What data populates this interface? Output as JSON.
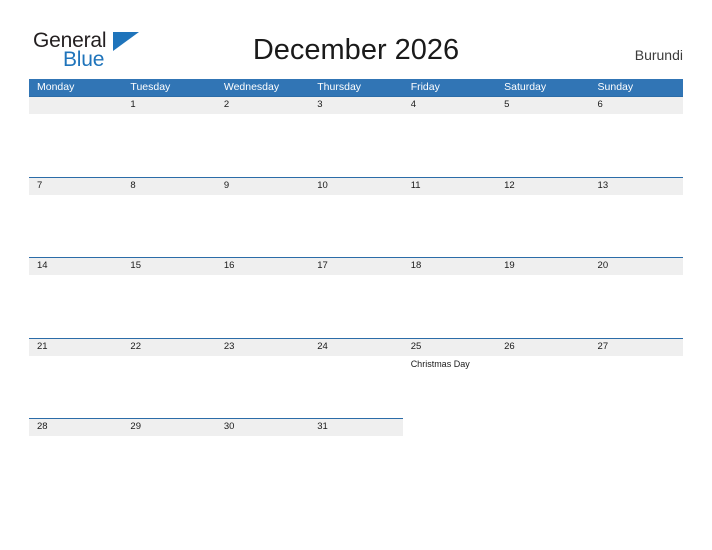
{
  "logo": {
    "word_one": "General",
    "word_two": "Blue",
    "triangle_icon": "triangle-icon"
  },
  "header": {
    "title": "December 2026",
    "country": "Burundi"
  },
  "colors": {
    "header_blue": "#3175b5",
    "band_gray": "#efefef",
    "band_rule": "#2b6ca8",
    "logo_blue": "#1f74bb",
    "text": "#1a1a1a"
  },
  "calendar": {
    "weekday_headers": [
      "Monday",
      "Tuesday",
      "Wednesday",
      "Thursday",
      "Friday",
      "Saturday",
      "Sunday"
    ],
    "weeks": [
      [
        {
          "day": "",
          "event": ""
        },
        {
          "day": "1",
          "event": ""
        },
        {
          "day": "2",
          "event": ""
        },
        {
          "day": "3",
          "event": ""
        },
        {
          "day": "4",
          "event": ""
        },
        {
          "day": "5",
          "event": ""
        },
        {
          "day": "6",
          "event": ""
        }
      ],
      [
        {
          "day": "7",
          "event": ""
        },
        {
          "day": "8",
          "event": ""
        },
        {
          "day": "9",
          "event": ""
        },
        {
          "day": "10",
          "event": ""
        },
        {
          "day": "11",
          "event": ""
        },
        {
          "day": "12",
          "event": ""
        },
        {
          "day": "13",
          "event": ""
        }
      ],
      [
        {
          "day": "14",
          "event": ""
        },
        {
          "day": "15",
          "event": ""
        },
        {
          "day": "16",
          "event": ""
        },
        {
          "day": "17",
          "event": ""
        },
        {
          "day": "18",
          "event": ""
        },
        {
          "day": "19",
          "event": ""
        },
        {
          "day": "20",
          "event": ""
        }
      ],
      [
        {
          "day": "21",
          "event": ""
        },
        {
          "day": "22",
          "event": ""
        },
        {
          "day": "23",
          "event": ""
        },
        {
          "day": "24",
          "event": ""
        },
        {
          "day": "25",
          "event": "Christmas Day"
        },
        {
          "day": "26",
          "event": ""
        },
        {
          "day": "27",
          "event": ""
        }
      ],
      [
        {
          "day": "28",
          "event": ""
        },
        {
          "day": "29",
          "event": ""
        },
        {
          "day": "30",
          "event": ""
        },
        {
          "day": "31",
          "event": ""
        },
        {
          "day": "",
          "event": ""
        },
        {
          "day": "",
          "event": ""
        },
        {
          "day": "",
          "event": ""
        }
      ]
    ]
  }
}
